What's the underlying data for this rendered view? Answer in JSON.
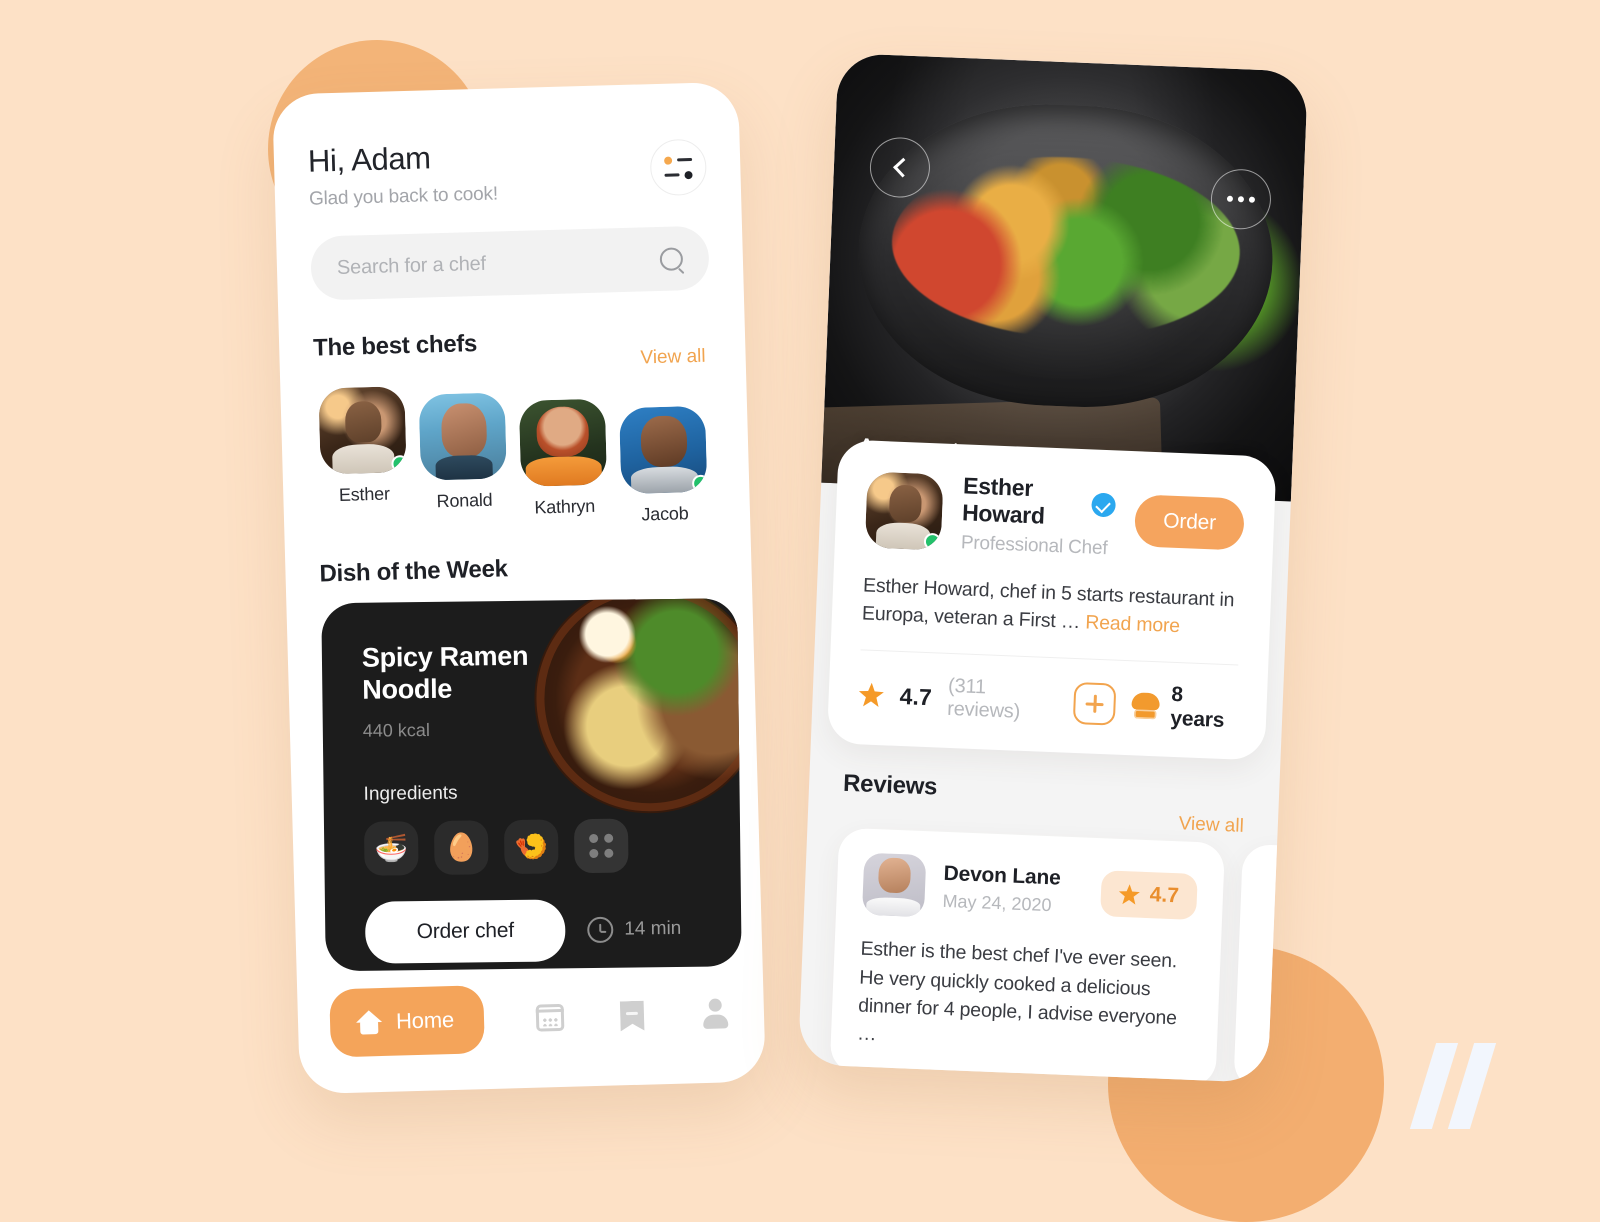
{
  "home": {
    "greeting": "Hi, Adam",
    "subtitle": "Glad you back to cook!",
    "filter_icon": "filter-icon",
    "search": {
      "placeholder": "Search for a chef",
      "icon": "search-icon"
    },
    "chefs_section": {
      "title": "The best chefs",
      "view_all": "View all",
      "chefs": [
        {
          "name": "Esther",
          "online": true
        },
        {
          "name": "Ronald",
          "online": false
        },
        {
          "name": "Kathryn",
          "online": false
        },
        {
          "name": "Jacob",
          "online": true
        }
      ]
    },
    "dish_section": {
      "title": "Dish of the Week",
      "dish_name": "Spicy Ramen Noodle",
      "calories": "440 kcal",
      "ingredients_label": "Ingredients",
      "ingredients": [
        {
          "icon": "ramen-emoji",
          "glyph": "🍜"
        },
        {
          "icon": "egg-emoji",
          "glyph": "🥚"
        },
        {
          "icon": "shrimp-emoji",
          "glyph": "🍤"
        },
        {
          "icon": "more-dots-icon",
          "glyph": ""
        }
      ],
      "order_button": "Order chef",
      "time_icon": "clock-icon",
      "time": "14 min"
    },
    "bottom_nav": [
      {
        "label": "Home",
        "icon": "home-icon",
        "active": true
      },
      {
        "label": "",
        "icon": "calendar-icon",
        "active": false
      },
      {
        "label": "",
        "icon": "bookmark-icon",
        "active": false
      },
      {
        "label": "",
        "icon": "profile-icon",
        "active": false
      }
    ]
  },
  "account": {
    "hero": {
      "title": "Account",
      "back_icon": "chevron-left-icon",
      "more_icon": "more-horizontal-icon"
    },
    "profile": {
      "name": "Esther Howard",
      "verified_icon": "verified-badge-icon",
      "role": "Professional Chef",
      "order_button": "Order",
      "bio": "Esther Howard, chef in 5 starts restaurant in Europa, veteran a First … ",
      "read_more": "Read more",
      "rating": "4.7",
      "reviews_count": "(311 reviews)",
      "add_icon": "plus-icon",
      "experience_icon": "chef-hat-icon",
      "experience": "8 years",
      "online": true
    },
    "reviews_section": {
      "title": "Reviews",
      "view_all": "View all",
      "reviews": [
        {
          "name": "Devon Lane",
          "date": "May 24, 2020",
          "rating": "4.7",
          "text": "Esther is the best chef I've ever seen. He very quickly cooked a delicious dinner for 4 people, I advise everyone …"
        }
      ]
    }
  },
  "branding": {
    "watermark_icon": "double-slash-logo"
  },
  "colors": {
    "page_background": "#FDE1C6",
    "accent_orange": "#F4A45A",
    "decor_orange": "#F3B478",
    "dark_card": "#1C1C1C",
    "online_green": "#23C16B",
    "verified_blue": "#2BA8EF",
    "star_orange": "#F59A28",
    "badge_background": "#FCE6D1"
  }
}
